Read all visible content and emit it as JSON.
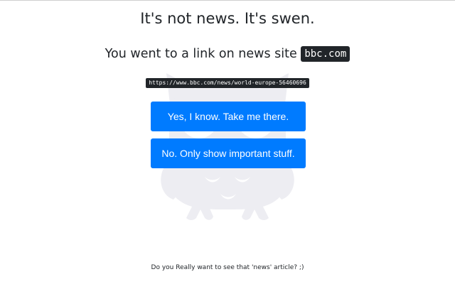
{
  "header": {
    "title": "It's not news. It's swen."
  },
  "notice": {
    "prefix": "You went to a link on news site",
    "site": "bbc.com",
    "url": "https://www.bbc.com/news/world-europe-56460696"
  },
  "actions": {
    "yes_label": "Yes, I know. Take me there.",
    "no_label": "No. Only show important stuff."
  },
  "footer": {
    "text": "Do you Really want to see that 'news' article? ;)"
  },
  "theme": {
    "button_color": "#007bff",
    "code_background": "#212529",
    "owl_color": "#ededf2",
    "owl_icon": "owl-icon"
  }
}
